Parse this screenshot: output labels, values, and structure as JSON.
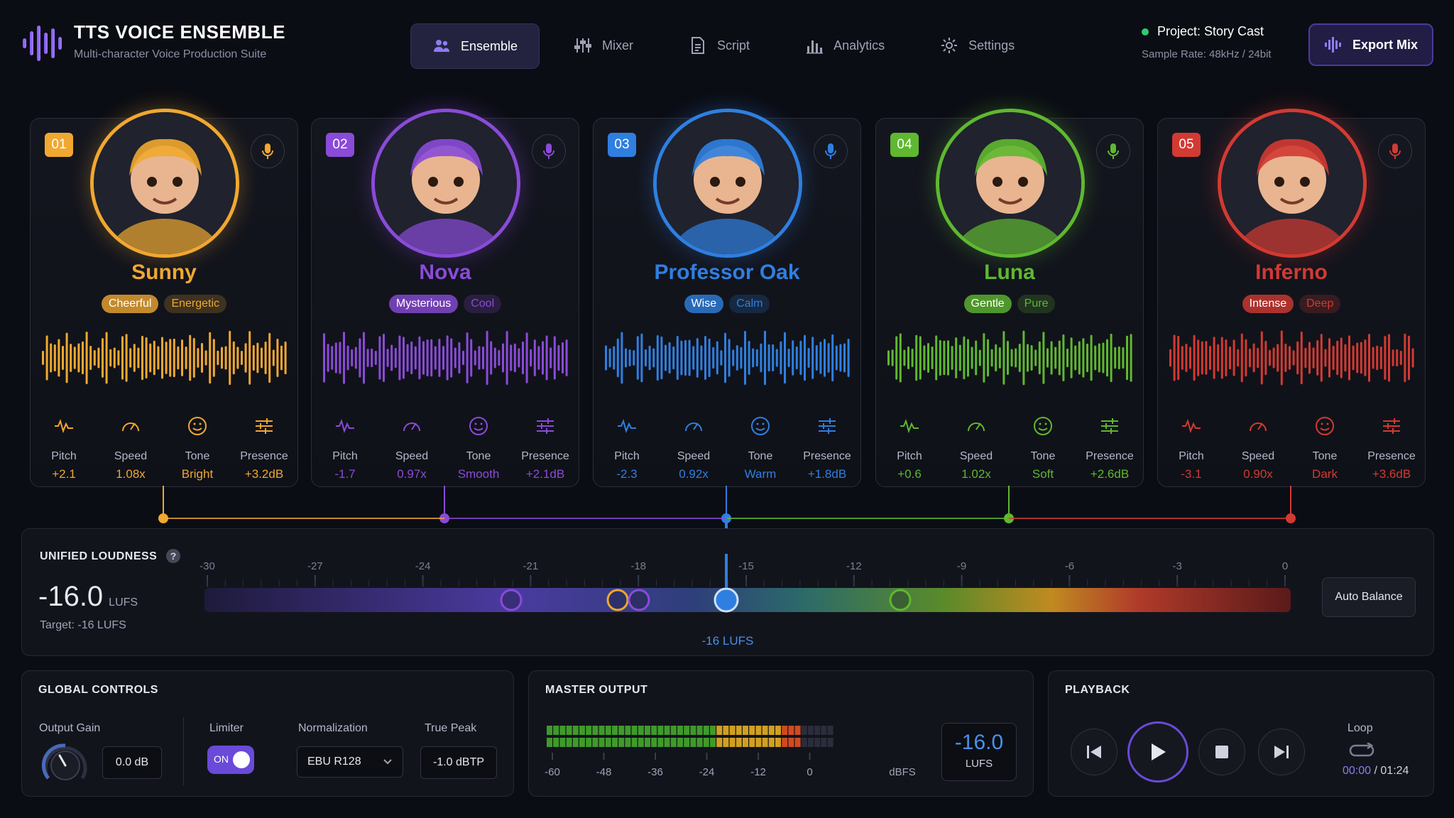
{
  "app": {
    "title": "TTS VOICE ENSEMBLE",
    "subtitle": "Multi-character Voice Production Suite"
  },
  "nav": [
    {
      "label": "Ensemble",
      "icon": "users-icon",
      "active": true
    },
    {
      "label": "Mixer",
      "icon": "sliders-icon",
      "active": false
    },
    {
      "label": "Script",
      "icon": "document-icon",
      "active": false
    },
    {
      "label": "Analytics",
      "icon": "bar-chart-icon",
      "active": false
    },
    {
      "label": "Settings",
      "icon": "gear-icon",
      "active": false
    }
  ],
  "project": {
    "name": "Project: Story Cast",
    "sample_rate": "Sample Rate: 48kHz / 24bit",
    "status_color": "#2ecc71"
  },
  "export_label": "Export Mix",
  "param_labels": {
    "pitch": "Pitch",
    "speed": "Speed",
    "tone": "Tone",
    "presence": "Presence"
  },
  "voices": [
    {
      "id": "01",
      "name": "Sunny",
      "color": "#f0a830",
      "tags": [
        "Cheerful",
        "Energetic"
      ],
      "pitch": "+2.1",
      "speed": "1.08x",
      "tone": "Bright",
      "presence": "+3.2dB",
      "level_lufs": -16
    },
    {
      "id": "02",
      "name": "Nova",
      "color": "#8a4bd8",
      "tags": [
        "Mysterious",
        "Cool"
      ],
      "pitch": "-1.7",
      "speed": "0.97x",
      "tone": "Smooth",
      "presence": "+2.1dB",
      "level_lufs": -16
    },
    {
      "id": "03",
      "name": "Professor Oak",
      "color": "#2f7fe0",
      "tags": [
        "Wise",
        "Calm"
      ],
      "pitch": "-2.3",
      "speed": "0.92x",
      "tone": "Warm",
      "presence": "+1.8dB",
      "level_lufs": -16
    },
    {
      "id": "04",
      "name": "Luna",
      "color": "#5fb830",
      "tags": [
        "Gentle",
        "Pure"
      ],
      "pitch": "+0.6",
      "speed": "1.02x",
      "tone": "Soft",
      "presence": "+2.6dB",
      "level_lufs": -16
    },
    {
      "id": "05",
      "name": "Inferno",
      "color": "#d23a32",
      "tags": [
        "Intense",
        "Deep"
      ],
      "pitch": "-3.1",
      "speed": "0.90x",
      "tone": "Dark",
      "presence": "+3.6dB",
      "level_lufs": -16
    }
  ],
  "loudness": {
    "title": "UNIFIED LOUDNESS",
    "value": "-16.0",
    "unit": "LUFS",
    "target": "Target: -16 LUFS",
    "scale": [
      "-30",
      "-27",
      "-24",
      "-21",
      "-18",
      "-15",
      "-12",
      "-9",
      "-6",
      "-3",
      "0"
    ],
    "marker_label": "-16 LUFS",
    "auto_balance": "Auto Balance"
  },
  "global": {
    "title": "GLOBAL CONTROLS",
    "output_gain_label": "Output Gain",
    "output_gain": "0.0 dB",
    "limiter_label": "Limiter",
    "limiter_state": "ON",
    "normalization_label": "Normalization",
    "normalization": "EBU R128",
    "true_peak_label": "True Peak",
    "true_peak": "-1.0 dBTP"
  },
  "master": {
    "title": "MASTER OUTPUT",
    "scale": [
      "-60",
      "-48",
      "-36",
      "-24",
      "-12",
      "0"
    ],
    "unit": "dBFS",
    "value": "-16.0",
    "value_unit": "LUFS",
    "meter_level_fraction": 0.89
  },
  "playback": {
    "title": "PLAYBACK",
    "loop_label": "Loop",
    "current": "00:00",
    "separator": " / ",
    "total": "01:24"
  }
}
